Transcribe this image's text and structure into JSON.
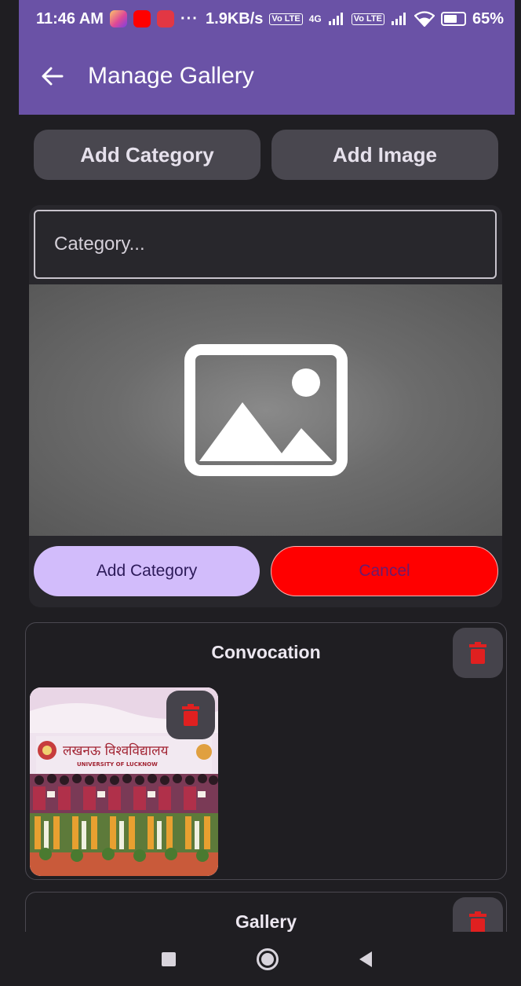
{
  "status_bar": {
    "time": "11:46 AM",
    "more": "···",
    "speed": "1.9KB/s",
    "sim1_badge": "Vo LTE",
    "sim2_badge": "Vo LTE",
    "network": "4G",
    "battery": "65%"
  },
  "app_bar": {
    "title": "Manage Gallery",
    "back_label": "back"
  },
  "top_buttons": {
    "add_category": "Add Category",
    "add_image": "Add Image"
  },
  "add_form": {
    "placeholder": "Category...",
    "value": "",
    "submit_label": "Add Category",
    "cancel_label": "Cancel"
  },
  "categories": [
    {
      "name": "Convocation"
    },
    {
      "name": "Gallery"
    }
  ],
  "thumbnail": {
    "hindi_text": "लखनऊ विश्वविद्यालय",
    "english_text": "UNIVERSITY OF LUCKNOW"
  },
  "colors": {
    "app_bar": "#6a52a6",
    "background": "#1f1e22",
    "submit_button": "#d2bcfb",
    "cancel_button": "#ff0000",
    "delete_icon": "#e02020"
  }
}
